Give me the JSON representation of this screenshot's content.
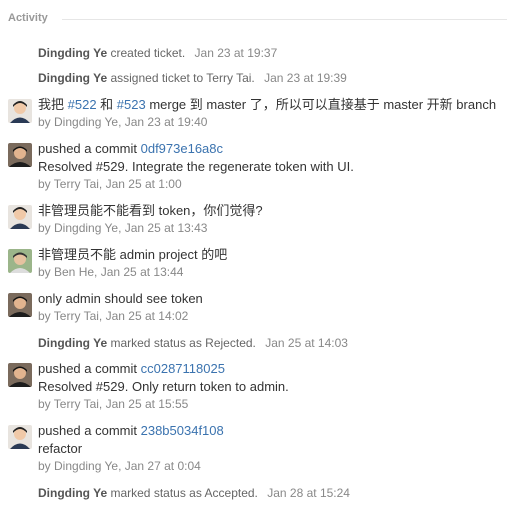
{
  "activity": {
    "title": "Activity",
    "items": [
      {
        "type": "event",
        "user": "Dingding Ye",
        "action": "created ticket.",
        "time": "Jan 23 at 19:37"
      },
      {
        "type": "event",
        "user": "Dingding Ye",
        "action": "assigned ticket to Terry Tai.",
        "time": "Jan 23 at 19:39"
      },
      {
        "type": "comment",
        "avatar": "avatar-dingding",
        "pre": "我把 ",
        "link1": "#522",
        "mid": " 和 ",
        "link2": "#523",
        "post": " merge 到 master 了，所以可以直接基于 master 开新 branch",
        "meta": "by Dingding Ye, Jan 23 at 19:40"
      },
      {
        "type": "commit",
        "avatar": "avatar-terry",
        "prefix": "pushed a commit ",
        "hash": "0df973e16a8c",
        "message": "Resolved #529. Integrate the regenerate token with UI.",
        "meta": "by Terry Tai, Jan 25 at 1:00"
      },
      {
        "type": "comment",
        "avatar": "avatar-dingding",
        "text": "非管理员能不能看到 token，你们觉得?",
        "meta": "by Dingding Ye, Jan 25 at 13:43"
      },
      {
        "type": "comment",
        "avatar": "avatar-ben",
        "text": "非管理员不能 admin project 的吧",
        "meta": "by Ben He, Jan 25 at 13:44"
      },
      {
        "type": "comment",
        "avatar": "avatar-terry",
        "text": "only admin should see token",
        "meta": "by Terry Tai, Jan 25 at 14:02"
      },
      {
        "type": "event",
        "user": "Dingding Ye",
        "action": "marked status as Rejected.",
        "time": "Jan 25 at 14:03"
      },
      {
        "type": "commit",
        "avatar": "avatar-terry",
        "prefix": "pushed a commit ",
        "hash": "cc0287118025",
        "message": "Resolved #529. Only return token to admin.",
        "meta": "by Terry Tai, Jan 25 at 15:55"
      },
      {
        "type": "commit",
        "avatar": "avatar-dingding",
        "prefix": "pushed a commit ",
        "hash": "238b5034f108",
        "message": "refactor",
        "meta": "by Dingding Ye, Jan 27 at 0:04"
      },
      {
        "type": "event",
        "user": "Dingding Ye",
        "action": "marked status as Accepted.",
        "time": "Jan 28 at 15:24"
      }
    ]
  },
  "colors": {
    "link": "#3b73af",
    "meta": "#888888",
    "header": "#999999"
  }
}
